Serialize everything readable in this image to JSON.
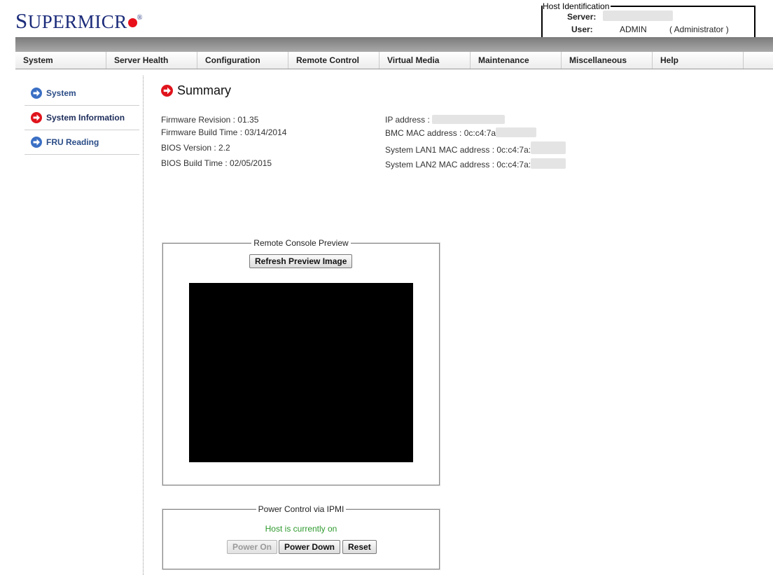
{
  "brand": {
    "first": "S",
    "rest": "UPERMICR",
    "reg": "®"
  },
  "host_identification": {
    "legend": "Host Identification",
    "server_label": "Server:",
    "server_value": "",
    "user_label": "User:",
    "user_value": "ADMIN",
    "user_role": "( Administrator )"
  },
  "nav": {
    "items": [
      "System",
      "Server Health",
      "Configuration",
      "Remote Control",
      "Virtual Media",
      "Maintenance",
      "Miscellaneous",
      "Help"
    ]
  },
  "sidebar": {
    "items": [
      {
        "label": "System",
        "icon": "arrow-right-blue-icon",
        "color": "#3a6fc4"
      },
      {
        "label": "System Information",
        "icon": "arrow-right-red-icon",
        "color": "#e0141c",
        "active": true
      },
      {
        "label": "FRU Reading",
        "icon": "arrow-right-blue-icon",
        "color": "#3a6fc4"
      }
    ]
  },
  "summary": {
    "title": "Summary",
    "firmware_revision": "Firmware Revision : 01.35",
    "firmware_build_time": "Firmware Build Time : 03/14/2014",
    "bios_version": "BIOS Version :  2.2",
    "bios_build_time": "BIOS Build Time :  02/05/2015",
    "ip_address_label": "IP address :",
    "bmc_mac_label": "BMC MAC address :  0c:c4:7a",
    "lan1_mac_label": "System LAN1 MAC address :  0c:c4:7a:",
    "lan2_mac_label": "System LAN2 MAC address :  0c:c4:7a:"
  },
  "remote_console": {
    "legend": "Remote Console Preview",
    "refresh_button": "Refresh Preview Image"
  },
  "power_control": {
    "legend": "Power Control via IPMI",
    "status": "Host is currently on",
    "status_color": "#2e9a2e",
    "buttons": {
      "power_on": "Power On",
      "power_down": "Power Down",
      "reset": "Reset"
    }
  },
  "colors": {
    "brand": "#1c2c7a",
    "accent_red": "#e8101a",
    "link_blue": "#2b4d87"
  }
}
